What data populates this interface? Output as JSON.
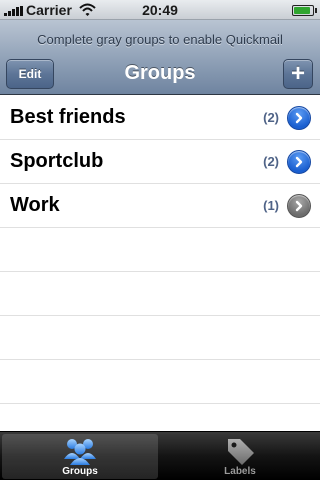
{
  "status_bar": {
    "carrier": "Carrier",
    "time": "20:49",
    "icons": [
      "signal-icon",
      "wifi-icon",
      "battery-icon"
    ]
  },
  "header": {
    "prompt": "Complete gray groups to enable Quickmail",
    "title": "Groups",
    "edit_label": "Edit",
    "add_label": "+"
  },
  "groups": [
    {
      "name": "Best friends",
      "count": "(2)",
      "status": "blue"
    },
    {
      "name": "Sportclub",
      "count": "(2)",
      "status": "blue"
    },
    {
      "name": "Work",
      "count": "(1)",
      "status": "gray"
    }
  ],
  "tabs": [
    {
      "label": "Groups",
      "icon": "people-icon",
      "selected": true
    },
    {
      "label": "Labels",
      "icon": "tag-icon",
      "selected": false
    }
  ],
  "colors": {
    "nav_gradient": "#8b9db4",
    "count_text": "#4f6387",
    "disclosure_blue": "#1a5fd0",
    "disclosure_gray": "#6c6c6c"
  }
}
